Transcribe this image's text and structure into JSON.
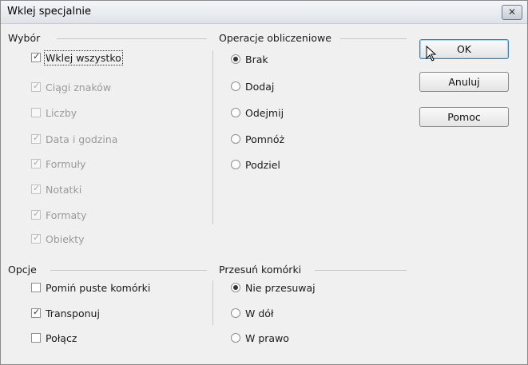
{
  "window": {
    "title": "Wklej specjalnie",
    "close_glyph": "✕"
  },
  "selection": {
    "label": "Wybór",
    "items": [
      {
        "label": "Wklej wszystko",
        "checked": true,
        "enabled": true
      },
      {
        "label": "Ciągi znaków",
        "checked": true,
        "enabled": false
      },
      {
        "label": "Liczby",
        "checked": false,
        "enabled": false
      },
      {
        "label": "Data i godzina",
        "checked": true,
        "enabled": false
      },
      {
        "label": "Formuły",
        "checked": true,
        "enabled": false
      },
      {
        "label": "Notatki",
        "checked": true,
        "enabled": false
      },
      {
        "label": "Formaty",
        "checked": true,
        "enabled": false
      },
      {
        "label": "Obiekty",
        "checked": true,
        "enabled": false
      }
    ]
  },
  "operations": {
    "label": "Operacje obliczeniowe",
    "items": [
      {
        "label": "Brak",
        "selected": true
      },
      {
        "label": "Dodaj",
        "selected": false
      },
      {
        "label": "Odejmij",
        "selected": false
      },
      {
        "label": "Pomnóż",
        "selected": false
      },
      {
        "label": "Podziel",
        "selected": false
      }
    ]
  },
  "options": {
    "label": "Opcje",
    "items": [
      {
        "label": "Pomiń puste komórki",
        "checked": false
      },
      {
        "label": "Transponuj",
        "checked": true
      },
      {
        "label": "Połącz",
        "checked": false
      }
    ]
  },
  "shift": {
    "label": "Przesuń komórki",
    "items": [
      {
        "label": "Nie przesuwaj",
        "selected": true
      },
      {
        "label": "W dół",
        "selected": false
      },
      {
        "label": "W prawo",
        "selected": false
      }
    ]
  },
  "buttons": {
    "ok": "OK",
    "cancel": "Anuluj",
    "help": "Pomoc"
  },
  "icons": {
    "check": "✓",
    "cursor": "mouse-pointer-icon"
  }
}
